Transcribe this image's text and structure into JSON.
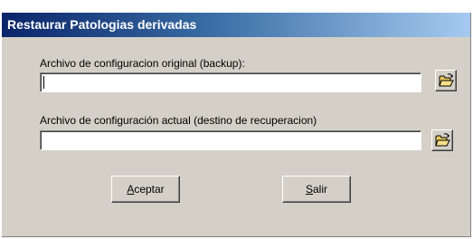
{
  "window": {
    "title": "Restaurar Patologias derivadas"
  },
  "form": {
    "original_label": "Archivo de configuracion original (backup):",
    "original_value": "",
    "current_label": "Archivo de configuración actual (destino de recuperacion)",
    "current_value": ""
  },
  "buttons": {
    "accept_mnemonic": "A",
    "accept_rest": "ceptar",
    "exit_mnemonic": "S",
    "exit_rest": "alir"
  },
  "icons": {
    "browse": "open-folder-icon"
  }
}
